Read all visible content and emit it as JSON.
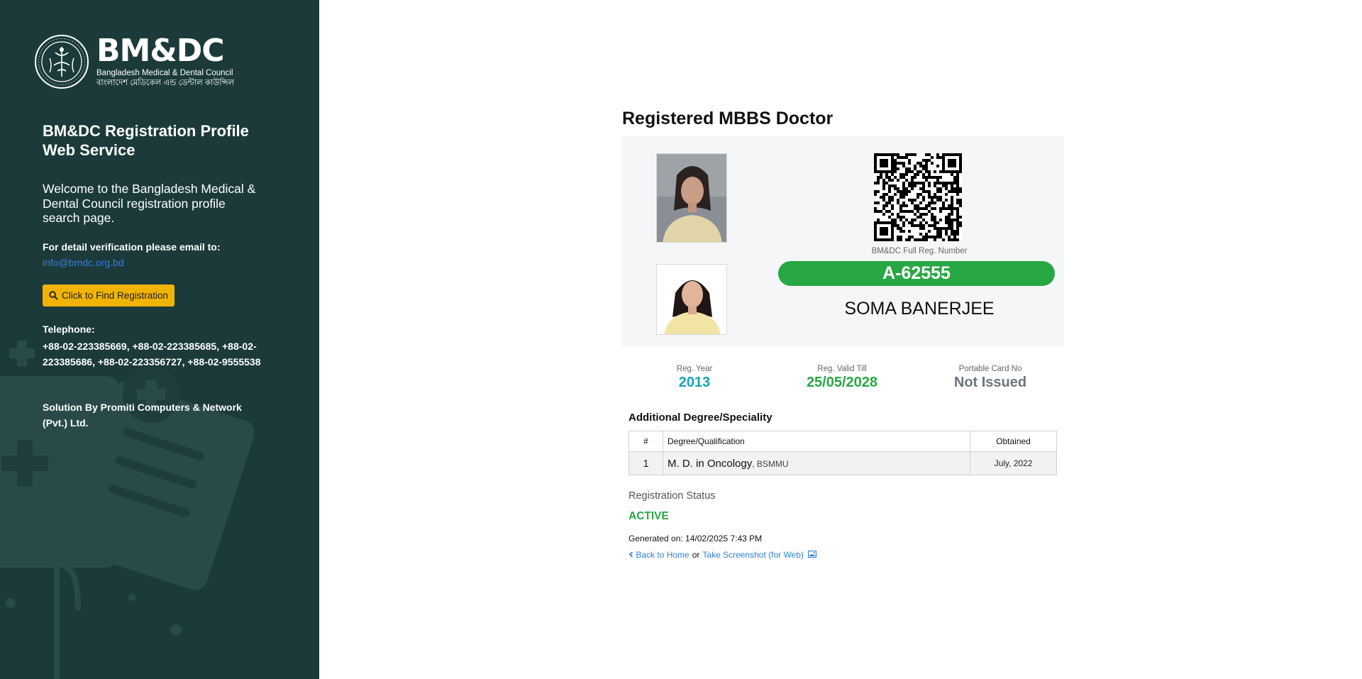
{
  "sidebar": {
    "logo": {
      "abbr": "BM&DC",
      "name_en": "Bangladesh Medical & Dental Council",
      "name_bn": "বাংলাদেশ মেডিকেল এন্ড ডেন্টাল কাউন্সিল",
      "seal_text": "BANGLADESH MEDICAL & DENTAL COUNCIL"
    },
    "title": "BM&DC Registration Profile Web Service",
    "welcome": "Welcome to the Bangladesh Medical & Dental Council registration profile search page.",
    "verify_label": "For detail verification please email to:",
    "email": "info@bmdc.org.bd",
    "find_button": "Click to Find Registration",
    "telephone_label": "Telephone:",
    "telephone": "+88-02-223385669, +88-02-223385685, +88-02-223385686, +88-02-223356727, +88-02-9555538",
    "solution": "Solution By Promiti Computers & Network (Pvt.) Ltd.",
    "bg_color": "#1c3a3a",
    "button_color": "#f0b400",
    "link_color": "#2f7fe0"
  },
  "main": {
    "title": "Registered MBBS Doctor",
    "reg_label": "BM&DC Full Reg. Number",
    "reg_number": "A-62555",
    "doctor_name": "SOMA BANERJEE",
    "stats": {
      "year_label": "Reg. Year",
      "year_value": "2013",
      "valid_label": "Reg. Valid Till",
      "valid_value": "25/05/2028",
      "card_label": "Portable Card No",
      "card_value": "Not Issued"
    },
    "additional_title": "Additional Degree/Speciality",
    "table": {
      "headers": [
        "#",
        "Degree/Qualification",
        "Obtained"
      ],
      "rows": [
        {
          "num": "1",
          "degree": "M. D. in Oncology",
          "institute": ", BSMMU",
          "obtained": "July, 2022"
        }
      ]
    },
    "status_label": "Registration Status",
    "status_value": "ACTIVE",
    "generated": "Generated on: 14/02/2025 7:43 PM",
    "back_link": "Back to Home",
    "or_text": "or",
    "screenshot_link": "Take Screenshot (for Web)",
    "colors": {
      "badge": "#28a745",
      "year": "#17a2b8",
      "valid": "#28a745",
      "card": "#6c757d",
      "status": "#28a745"
    },
    "icons": [
      "search-icon",
      "chevron-left-icon",
      "image-icon",
      "qr-code-icon"
    ]
  }
}
